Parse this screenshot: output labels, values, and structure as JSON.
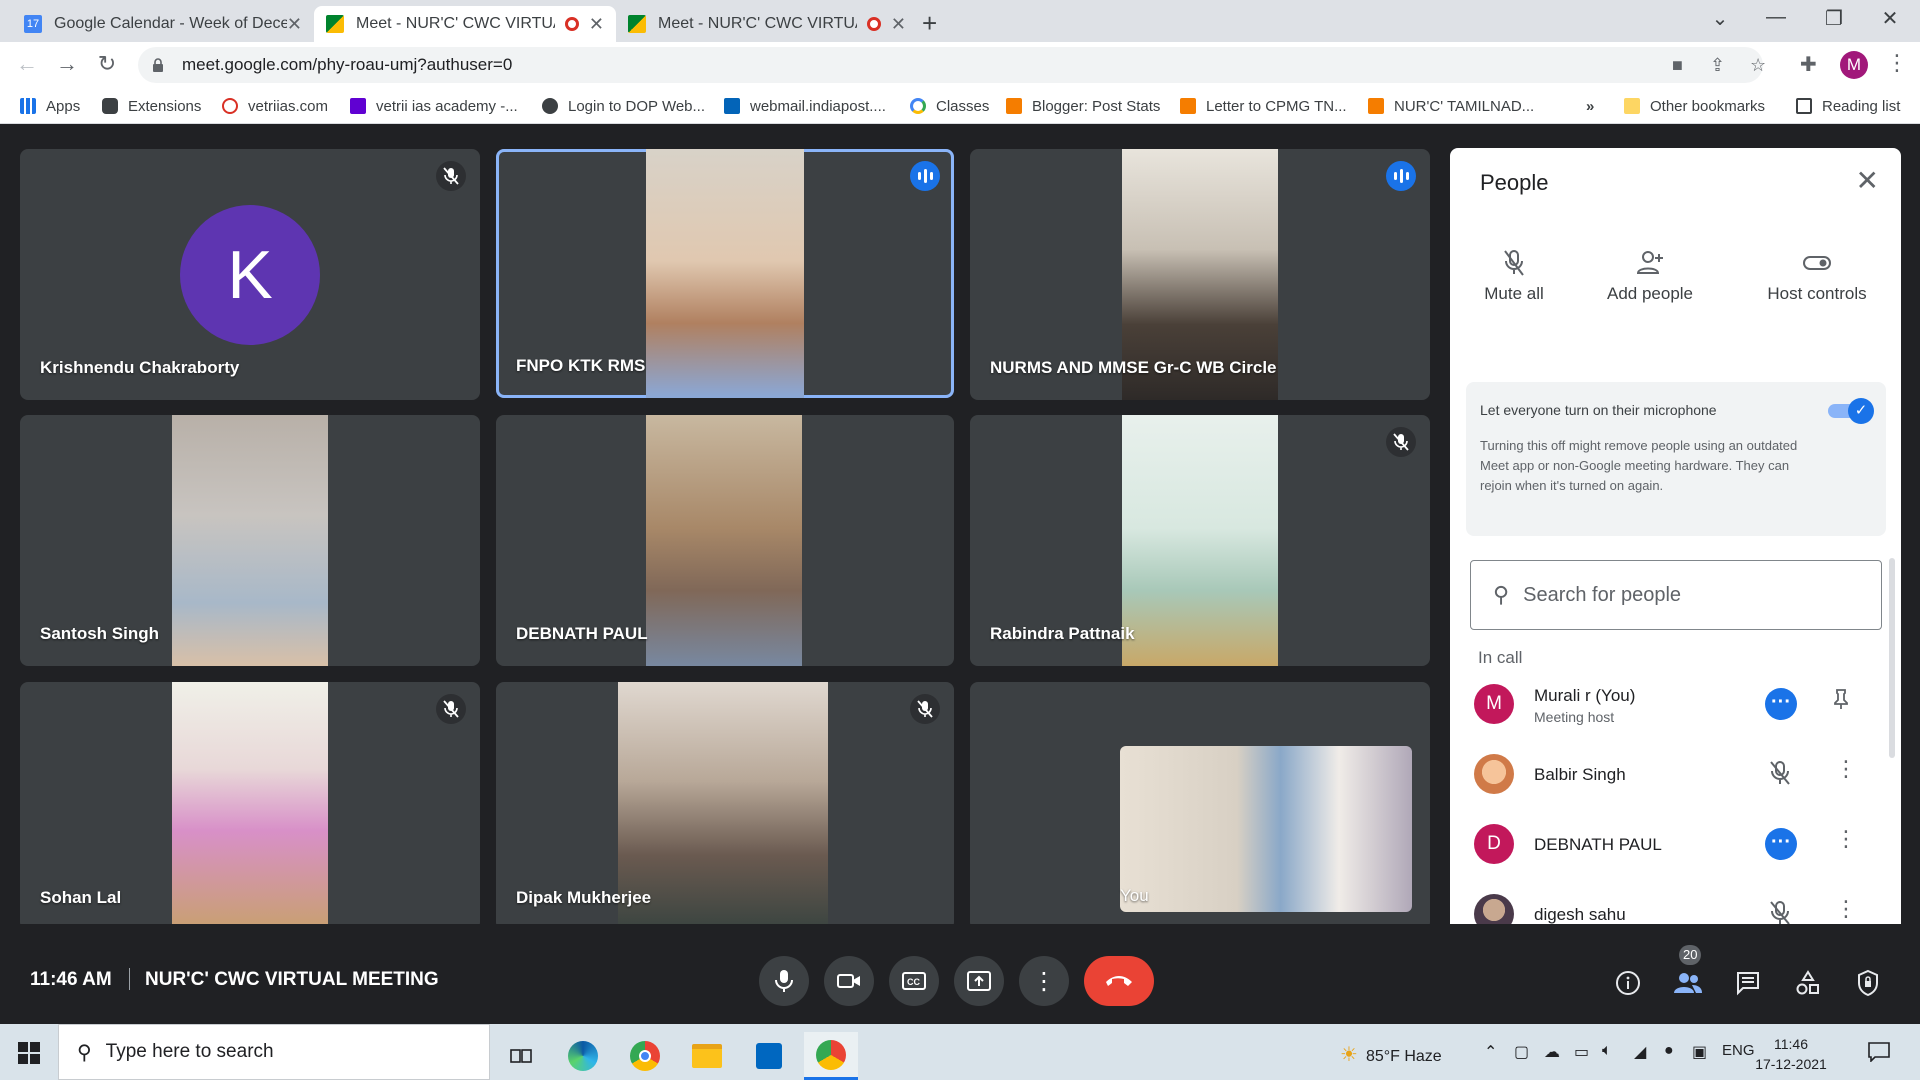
{
  "browser": {
    "tabs": [
      {
        "title": "Google Calendar - Week of Dece",
        "active": false
      },
      {
        "title": "Meet - NUR'C' CWC VIRTUAL",
        "active": true
      },
      {
        "title": "Meet - NUR'C' CWC VIRTUAL",
        "active": false
      }
    ],
    "url": "meet.google.com/phy-roau-umj?authuser=0",
    "profile_initial": "M",
    "bookmarks": [
      {
        "label": "Apps",
        "icon": "apps-grid-icon"
      },
      {
        "label": "Extensions",
        "icon": "puzzle-icon"
      },
      {
        "label": "vetriias.com",
        "icon": "site-icon"
      },
      {
        "label": "vetrii ias academy -...",
        "icon": "yahoo-icon"
      },
      {
        "label": "Login to DOP Web...",
        "icon": "globe-icon"
      },
      {
        "label": "webmail.indiapost....",
        "icon": "outlook-icon"
      },
      {
        "label": "Classes",
        "icon": "google-icon"
      },
      {
        "label": "Blogger: Post Stats",
        "icon": "blogger-icon"
      },
      {
        "label": "Letter to CPMG TN...",
        "icon": "blogger-icon"
      },
      {
        "label": "NUR'C' TAMILNAD...",
        "icon": "blogger-icon"
      }
    ],
    "bookmarks_overflow": "»",
    "other_bookmarks": "Other bookmarks",
    "reading_list": "Reading list"
  },
  "tiles": [
    {
      "name": "Krishnendu Chakraborty",
      "state": "muted",
      "avatar": "K"
    },
    {
      "name": "FNPO KTK RMS",
      "state": "speaking"
    },
    {
      "name": "NURMS AND MMSE Gr-C WB Circle",
      "state": "speaking"
    },
    {
      "name": "Santosh Singh",
      "state": "none"
    },
    {
      "name": "DEBNATH PAUL",
      "state": "none"
    },
    {
      "name": "Rabindra Pattnaik",
      "state": "muted"
    },
    {
      "name": "Sohan Lal",
      "state": "muted"
    },
    {
      "name": "Dipak Mukherjee",
      "state": "muted"
    },
    {
      "name": "You",
      "state": "self"
    }
  ],
  "people_panel": {
    "title": "People",
    "actions": {
      "mute_all": "Mute all",
      "add_people": "Add people",
      "host_controls": "Host controls"
    },
    "mic_setting": {
      "label": "Let everyone turn on their microphone",
      "enabled": true,
      "description": "Turning this off might remove people using an outdated Meet app or non-Google meeting hardware. They can rejoin when it's turned on again."
    },
    "search_placeholder": "Search for people",
    "section": "In call",
    "participants": [
      {
        "name": "Murali r (You)",
        "role": "Meeting host",
        "initial": "M",
        "color": "#c2185b"
      },
      {
        "name": "Balbir Singh",
        "initial": "",
        "color": "#f6a56b"
      },
      {
        "name": "DEBNATH PAUL",
        "initial": "D",
        "color": "#c2185b"
      },
      {
        "name": "digesh sahu",
        "initial": "",
        "color": "#6b5a7a"
      }
    ]
  },
  "meeting": {
    "time": "11:46 AM",
    "title": "NUR'C' CWC VIRTUAL MEETING",
    "participant_count": "20"
  },
  "taskbar": {
    "search_placeholder": "Type here to search",
    "weather": "85°F  Haze",
    "language": "ENG",
    "time": "11:46",
    "date": "17-12-2021"
  }
}
